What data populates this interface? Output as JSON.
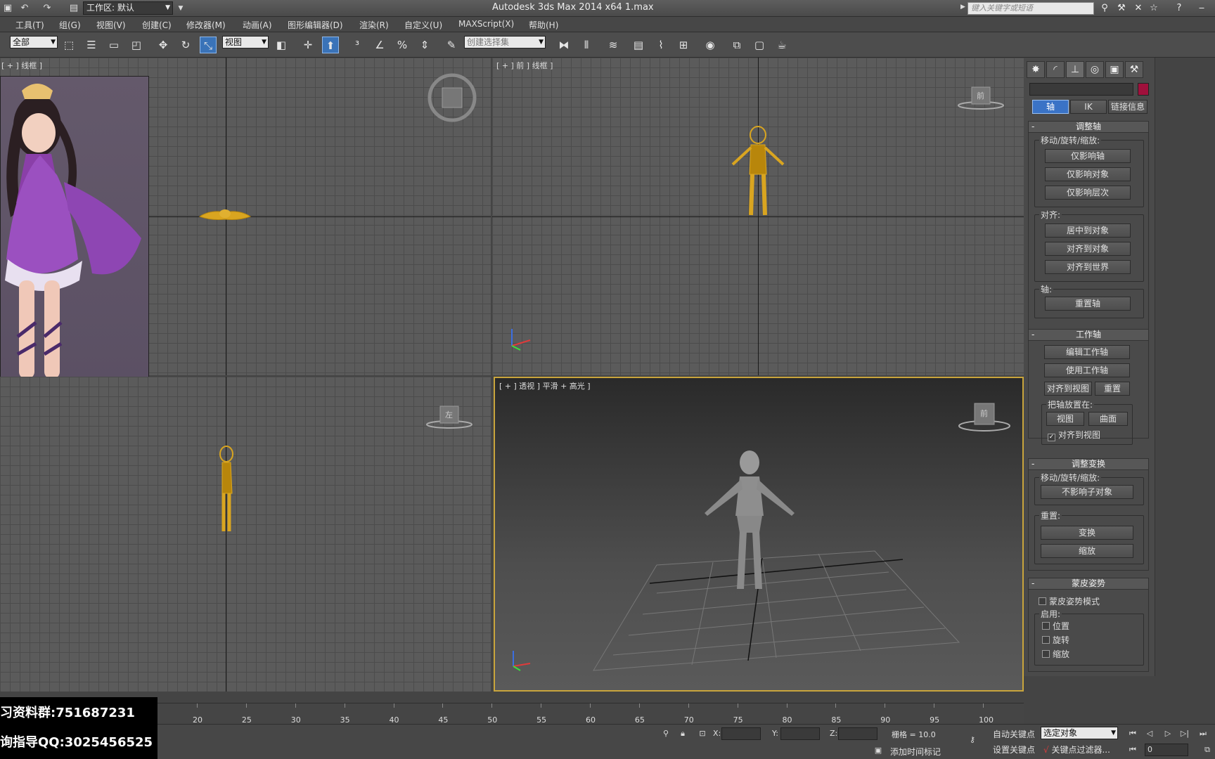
{
  "titlebar": {
    "workspace": "工作区: 默认",
    "app_title": "Autodesk 3ds Max  2014 x64      1.max",
    "search_placeholder": "键入关键字或短语"
  },
  "menu": [
    "工具(T)",
    "组(G)",
    "视图(V)",
    "创建(C)",
    "修改器(M)",
    "动画(A)",
    "图形编辑器(D)",
    "渲染(R)",
    "自定义(U)",
    "MAXScript(X)",
    "帮助(H)"
  ],
  "toolbar": {
    "filter_value": "全部",
    "refcoord_value": "视图",
    "selection_set_placeholder": "创建选择集"
  },
  "viewports": {
    "top_left_label": "[ + ] 线框 ]",
    "front_label": "[ + ] 前 ] 线框 ]",
    "persp_label": "[ + ] 透视 ] 平滑 + 高光 ]",
    "front_cube_label": "前",
    "left_cube_label": "左",
    "persp_cube_label": "前"
  },
  "cmdpanel": {
    "tabs": [
      "轴",
      "IK",
      "链接信息"
    ],
    "adjust_pivot": {
      "title": "调整轴",
      "move_rotate_scale": "移动/旋转/缩放:",
      "affect_pivot_only": "仅影响轴",
      "affect_object_only": "仅影响对象",
      "affect_hierarchy_only": "仅影响层次",
      "alignment": "对齐:",
      "center_to_object": "居中到对象",
      "align_to_object": "对齐到对象",
      "align_to_world": "对齐到世界",
      "pivot": "轴:",
      "reset_pivot": "重置轴"
    },
    "working_pivot": {
      "title": "工作轴",
      "edit_working_pivot": "编辑工作轴",
      "use_working_pivot": "使用工作轴",
      "align_to_view": "对齐到视图",
      "reset": "重置",
      "place_pivot_to": "把轴放置在:",
      "view": "视图",
      "surface": "曲面",
      "align_to_view_check": "对齐到视图"
    },
    "adjust_transform": {
      "title": "调整变换",
      "move_rotate_scale": "移动/旋转/缩放:",
      "dont_affect_children": "不影响子对象",
      "reset": "重置:",
      "transform": "变换",
      "scale": "缩放"
    },
    "skin_pose": {
      "title": "蒙皮姿势",
      "skin_pose_mode": "蒙皮姿势模式",
      "enable": "启用:",
      "position": "位置",
      "rotation": "旋转",
      "scale": "缩放"
    }
  },
  "timeline": {
    "ticks": [
      "20",
      "25",
      "30",
      "35",
      "40",
      "45",
      "50",
      "55",
      "60",
      "65",
      "70",
      "75",
      "80",
      "85",
      "90",
      "95",
      "100"
    ]
  },
  "status": {
    "x_label": "X:",
    "y_label": "Y:",
    "z_label": "Z:",
    "grid": "栅格 = 10.0",
    "auto_key": "自动关键点",
    "selected_object": "选定对象",
    "set_key": "设置关键点",
    "key_filters": "关键点过滤器...",
    "add_time_tag": "添加时间标记",
    "frame_value": "0"
  },
  "overlay": {
    "line1": "习资料群:751687231",
    "line2": "询指导QQ:3025456525"
  },
  "colors": {
    "accent_blue": "#3a73c6",
    "selection_yellow": "#d9a520",
    "active_viewport_border": "#c9a53c",
    "object_color_swatch": "#a0103c"
  }
}
